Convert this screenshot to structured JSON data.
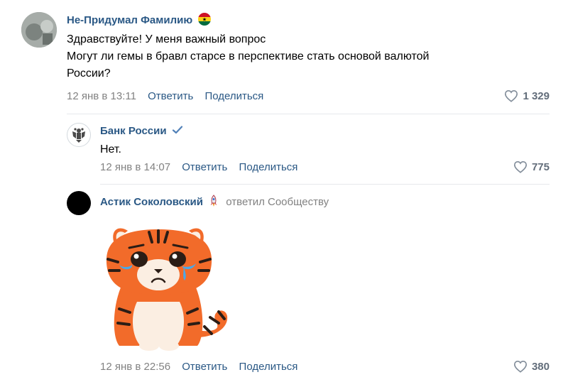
{
  "comments": [
    {
      "author": "Не-Придумал Фамилию",
      "flag": "ghana-flag",
      "text_lines": [
        "Здравствуйте! У меня важный вопрос",
        "Могут ли гемы в бравл старсе в перспективе стать основой валютой",
        "России?"
      ],
      "date": "12 янв в 13:11",
      "reply_label": "Ответить",
      "share_label": "Поделиться",
      "likes": "1 329"
    },
    {
      "author": "Банк России",
      "verified": true,
      "text": "Нет.",
      "date": "12 янв в 14:07",
      "reply_label": "Ответить",
      "share_label": "Поделиться",
      "likes": "775"
    },
    {
      "author": "Астик Соколовский",
      "badge": "rocket-icon",
      "replied_to": "ответил Сообществу",
      "sticker": "crying-tiger-sticker",
      "date": "12 янв в 22:56",
      "reply_label": "Ответить",
      "share_label": "Поделиться",
      "likes": "380"
    }
  ],
  "colors": {
    "link": "#2a5885",
    "meta": "#828282",
    "verified": "#5181b8",
    "tiger": "#f26b2a"
  }
}
